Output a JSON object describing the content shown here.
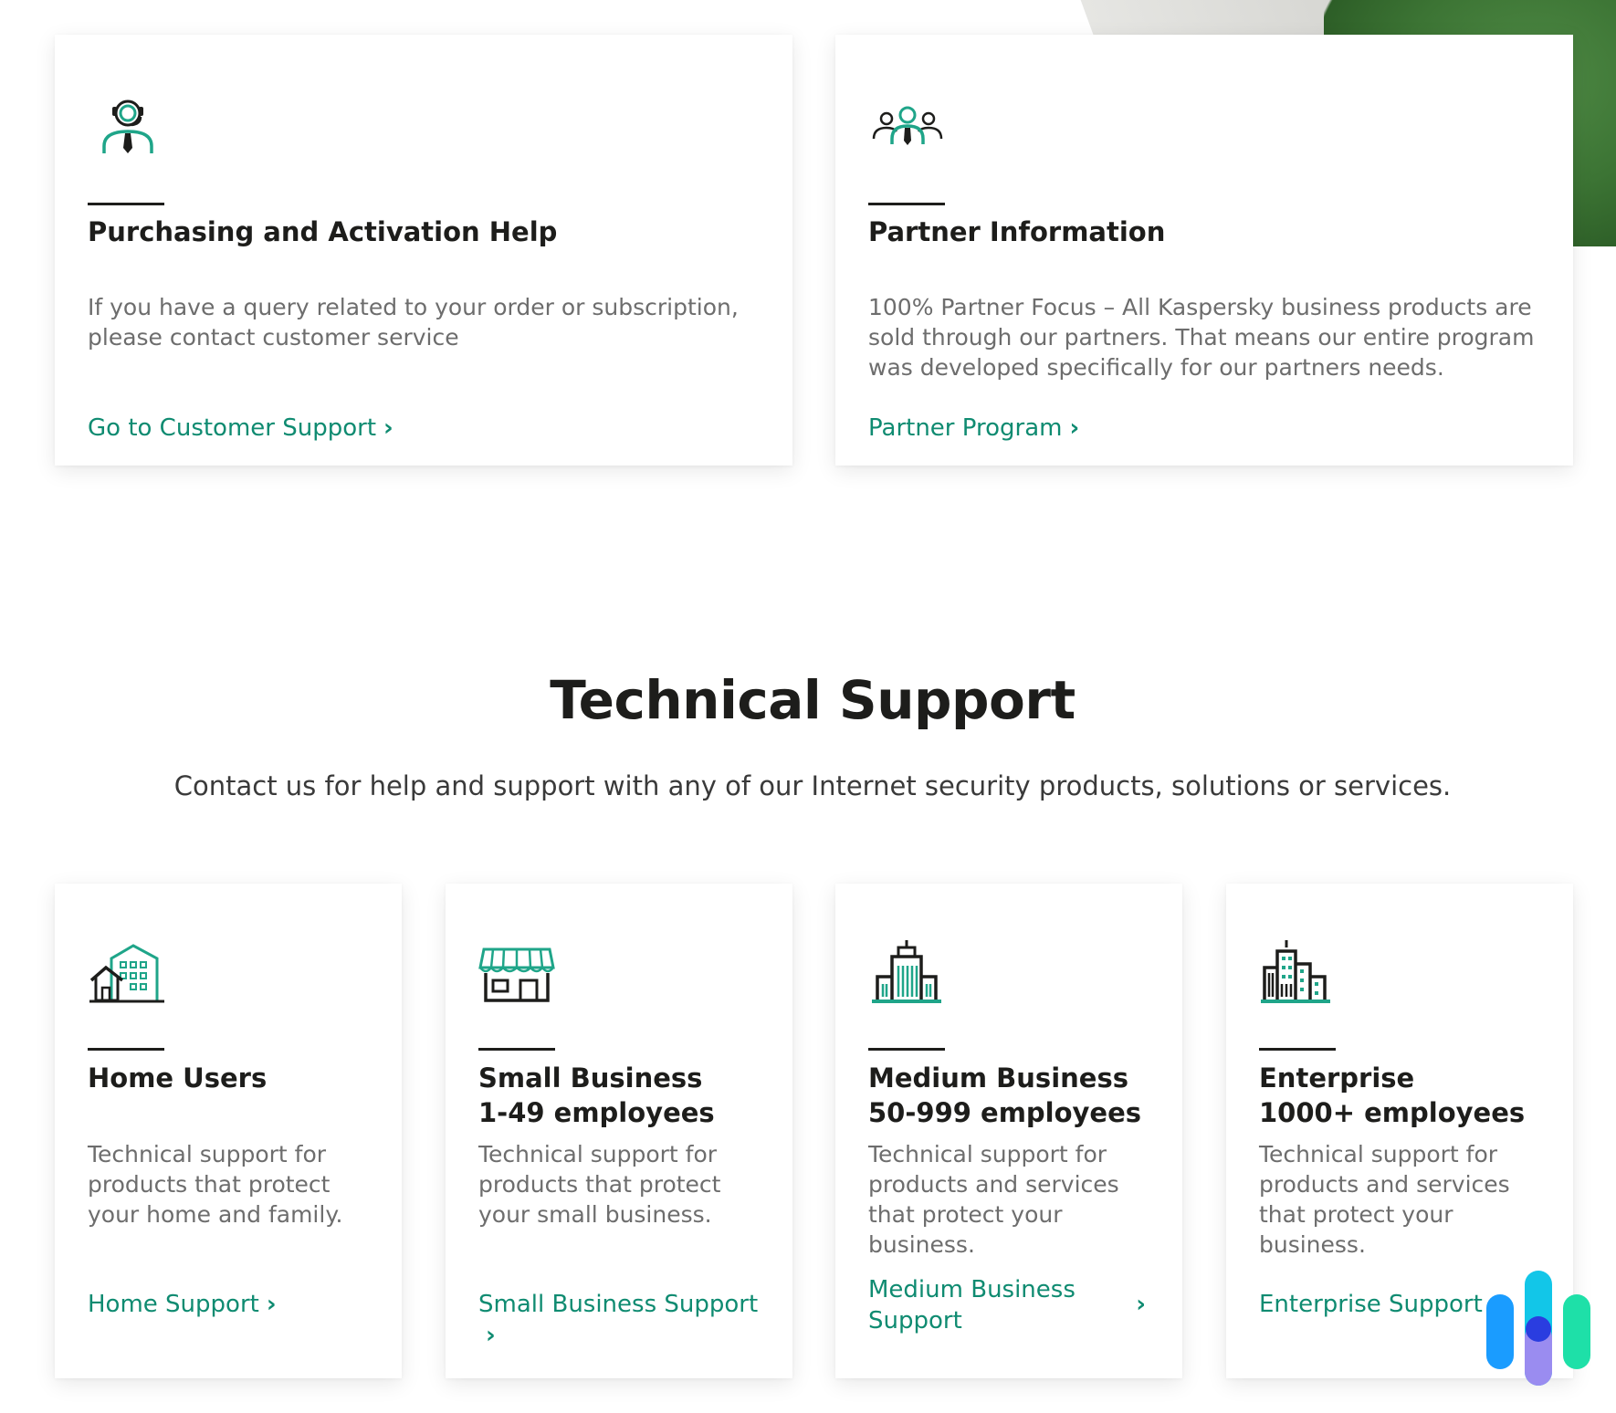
{
  "top_cards": [
    {
      "icon": "support-agent-icon",
      "title": "Purchasing and Activation Help",
      "description": "If you have a query related to your order or subscription, please contact customer service",
      "link": "Go to Customer Support"
    },
    {
      "icon": "partners-group-icon",
      "title": "Partner Information",
      "description": "100% Partner Focus – All Kaspersky business products are sold through our partners. That means our entire program was developed specifically for our partners needs.",
      "link": "Partner Program"
    }
  ],
  "technical_support": {
    "title": "Technical Support",
    "subtitle": "Contact us for help and support with any of our Internet security products, solutions or services."
  },
  "support_cards": [
    {
      "icon": "home-building-icon",
      "title_line1": "Home Users",
      "title_line2": "",
      "description": "Technical support for products that protect your home and family.",
      "link": "Home Support"
    },
    {
      "icon": "storefront-icon",
      "title_line1": "Small Business",
      "title_line2": "1-49 employees",
      "description": "Technical support for products that protect your small business.",
      "link": "Small Business Support"
    },
    {
      "icon": "office-tower-icon",
      "title_line1": "Medium Business",
      "title_line2": "50-999 employees",
      "description": "Technical support for products and services that protect your business.",
      "link": "Medium Business Support"
    },
    {
      "icon": "city-skyline-icon",
      "title_line1": "Enterprise",
      "title_line2": "1000+ employees",
      "description": "Technical support for products and services that protect your business.",
      "link": "Enterprise Support"
    }
  ],
  "colors": {
    "accent": "#0f8b71",
    "icon_teal": "#1fa589",
    "text_dark": "#1d1d1b",
    "text_muted": "#6d6d6d"
  },
  "chevron": "›"
}
